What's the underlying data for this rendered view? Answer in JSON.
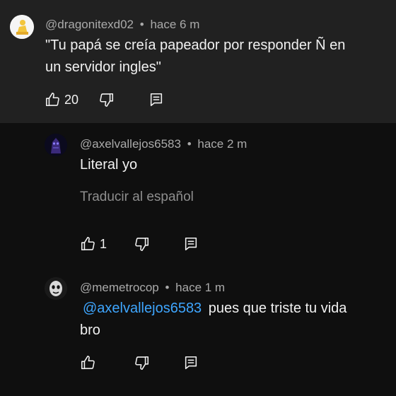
{
  "comments": [
    {
      "author": "@dragonitexd02",
      "separator": "•",
      "time": "hace 6 m",
      "text_line1": "\"Tu papá se creía papeador por responder Ñ en",
      "text_line2": "un servidor ingles\"",
      "likes": "20",
      "avatar_icon": "yellow-figure-avatar-icon"
    },
    {
      "author": "@axelvallejos6583",
      "separator": "•",
      "time": "hace 2 m",
      "text": "Literal yo",
      "translate_label": "Traducir al español",
      "likes": "1",
      "avatar_icon": "dark-purple-creature-avatar-icon"
    },
    {
      "author": "@memetrocop",
      "separator": "•",
      "time": "hace 1 m",
      "mention": "@axelvallejos6583",
      "text_after_mention": "pues que triste tu vida",
      "text_line2": "bro",
      "avatar_icon": "mask-face-avatar-icon"
    }
  ],
  "colors": {
    "background": "#0f0f0f",
    "highlight_background": "#212121",
    "meta_text": "#aaaaaa",
    "mention": "#3ea6ff"
  }
}
